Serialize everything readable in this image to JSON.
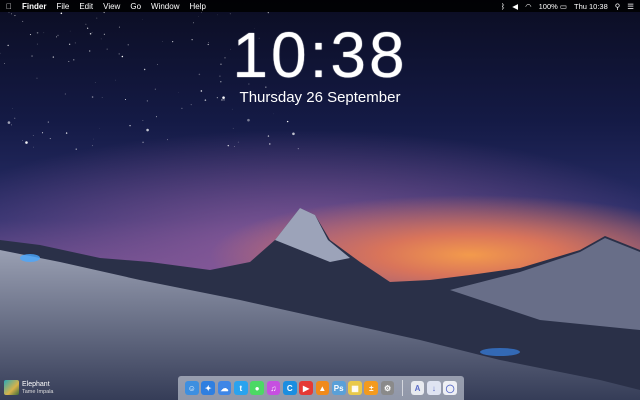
{
  "menubar": {
    "apple": "",
    "app": "Finder",
    "items": [
      "File",
      "Edit",
      "View",
      "Go",
      "Window",
      "Help"
    ],
    "battery": "100%",
    "clock": "Thu 10:38"
  },
  "lockscreen": {
    "time": "10:38",
    "date": "Thursday 26 September"
  },
  "now_playing": {
    "title": "Elephant",
    "artist": "Tame Impala"
  },
  "dock": {
    "apps": [
      {
        "name": "finder",
        "color": "#3d8fe0",
        "glyph": "☺"
      },
      {
        "name": "safari",
        "color": "#2f7fe0",
        "glyph": "✦"
      },
      {
        "name": "icloud",
        "color": "#3e86e6",
        "glyph": "☁"
      },
      {
        "name": "twitter",
        "color": "#2aa3ef",
        "glyph": "t"
      },
      {
        "name": "messages",
        "color": "#4cd964",
        "glyph": "●"
      },
      {
        "name": "itunes",
        "color": "#c64fe0",
        "glyph": "♫"
      },
      {
        "name": "app-blue",
        "color": "#1a8ee0",
        "glyph": "C"
      },
      {
        "name": "youtube",
        "color": "#e53935",
        "glyph": "▶"
      },
      {
        "name": "vlc",
        "color": "#f08a1c",
        "glyph": "▲"
      },
      {
        "name": "photoshop",
        "color": "#5aa0d8",
        "glyph": "Ps"
      },
      {
        "name": "preview",
        "color": "#e9c94a",
        "glyph": "▦"
      },
      {
        "name": "calculator",
        "color": "#f39a1e",
        "glyph": "±"
      },
      {
        "name": "system-preferences",
        "color": "#8a8a8a",
        "glyph": "⚙"
      }
    ],
    "stack": [
      {
        "name": "applications",
        "color": "#e8ebf0",
        "glyph": "A"
      },
      {
        "name": "downloads",
        "color": "#dfe4f2",
        "glyph": "↓"
      },
      {
        "name": "siri",
        "color": "#eef0f5",
        "glyph": "◯"
      }
    ]
  }
}
